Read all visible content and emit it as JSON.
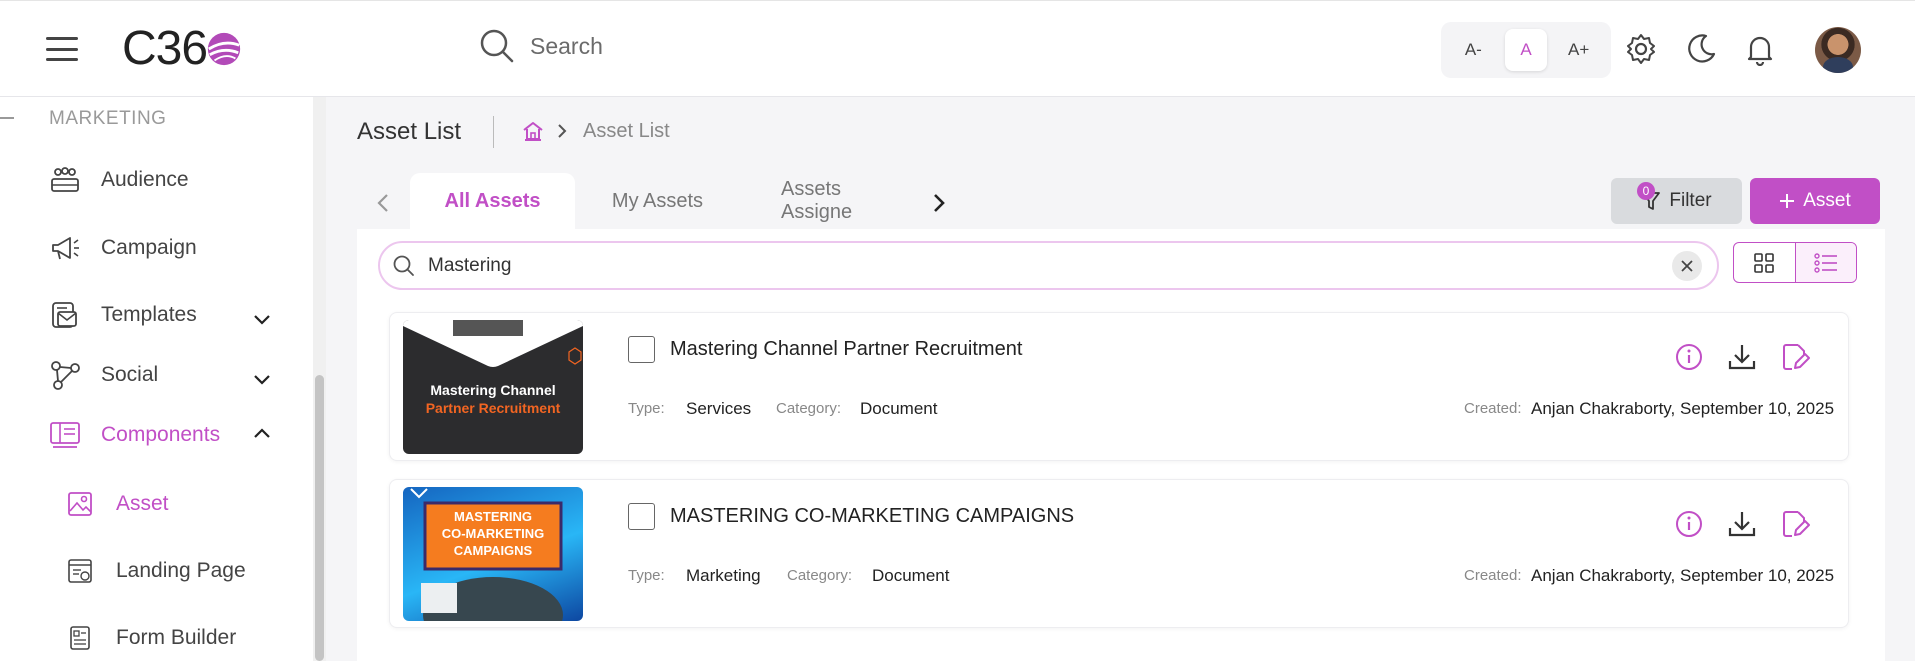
{
  "header": {
    "logo_text": "C36",
    "search_placeholder": "Search",
    "font_controls": [
      "A-",
      "A",
      "A+"
    ],
    "icons": [
      "menu-icon",
      "search-icon",
      "gear-icon",
      "moon-icon",
      "bell-icon"
    ]
  },
  "sidebar": {
    "section": "MARKETING",
    "items": [
      {
        "label": "Audience",
        "icon": "audience-icon"
      },
      {
        "label": "Campaign",
        "icon": "megaphone-icon"
      },
      {
        "label": "Templates",
        "icon": "templates-icon"
      },
      {
        "label": "Social",
        "icon": "share-icon"
      },
      {
        "label": "Components",
        "icon": "components-icon"
      },
      {
        "label": "Asset",
        "icon": "image-icon"
      },
      {
        "label": "Landing Page",
        "icon": "landing-page-icon"
      },
      {
        "label": "Form Builder",
        "icon": "form-icon"
      }
    ]
  },
  "page": {
    "title": "Asset List",
    "breadcrumb": "Asset List"
  },
  "tabs": [
    {
      "label": "All Assets"
    },
    {
      "label": "My Assets"
    },
    {
      "label": "Assets Assigne"
    }
  ],
  "toolbar": {
    "filter_label": "Filter",
    "filter_count": "0",
    "add_label": "Asset"
  },
  "search": {
    "value": "Mastering"
  },
  "meta_labels": {
    "type": "Type:",
    "category": "Category:",
    "created": "Created:"
  },
  "assets": [
    {
      "title": "Mastering Channel Partner Recruitment",
      "thumb_line1": "Mastering Channel",
      "thumb_line2": "Partner Recruitment",
      "type": "Services",
      "category": "Document",
      "created": "Anjan Chakraborty, September 10, 2025"
    },
    {
      "title": "MASTERING CO-MARKETING CAMPAIGNS",
      "thumb_line1": "MASTERING",
      "thumb_line2": "CO-MARKETING",
      "thumb_line3": "CAMPAIGNS",
      "type": "Marketing",
      "category": "Document",
      "created": "Anjan Chakraborty, September 10, 2025"
    }
  ],
  "colors": {
    "accent": "#c14fc6",
    "filter_bg": "#d9dbde",
    "thumb1_bg": "#2c2c2e",
    "thumb1_highlight": "#f26522",
    "thumb2_bg": "#1e88e5",
    "thumb2_box": "#f57c1f"
  }
}
